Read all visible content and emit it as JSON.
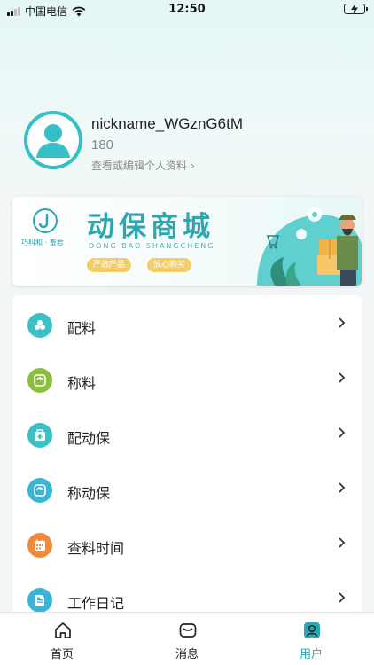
{
  "status_bar": {
    "carrier": "中国电信",
    "time": "12:50"
  },
  "profile": {
    "nickname": "nickname_WGznG6tM",
    "phone": "180",
    "edit_link": "查看或编辑个人资料"
  },
  "banner": {
    "brand": "巧科和 · 畜君",
    "title": "动保商城",
    "subtitle": "DONG BAO SHANGCHENG",
    "tag1": "严选产品",
    "tag2": "放心购买"
  },
  "menu": [
    {
      "label": "配料",
      "icon": "ingredients-icon",
      "color": "#3cc0c8"
    },
    {
      "label": "称料",
      "icon": "scale-icon",
      "color": "#8cbf3f"
    },
    {
      "label": "配动保",
      "icon": "medicine-box-icon",
      "color": "#3cc0c8"
    },
    {
      "label": "称动保",
      "icon": "scale-icon",
      "color": "#3ab5d6"
    },
    {
      "label": "查料时间",
      "icon": "calendar-icon",
      "color": "#f08a3a"
    },
    {
      "label": "工作日记",
      "icon": "diary-icon",
      "color": "#3ab5d6"
    }
  ],
  "tabs": [
    {
      "label": "首页",
      "icon": "home-icon"
    },
    {
      "label": "消息",
      "icon": "message-icon"
    },
    {
      "label": "用户",
      "icon": "user-icon",
      "active": true
    }
  ],
  "colors": {
    "accent": "#2aa7b0",
    "tag": "#f3cd6a"
  }
}
